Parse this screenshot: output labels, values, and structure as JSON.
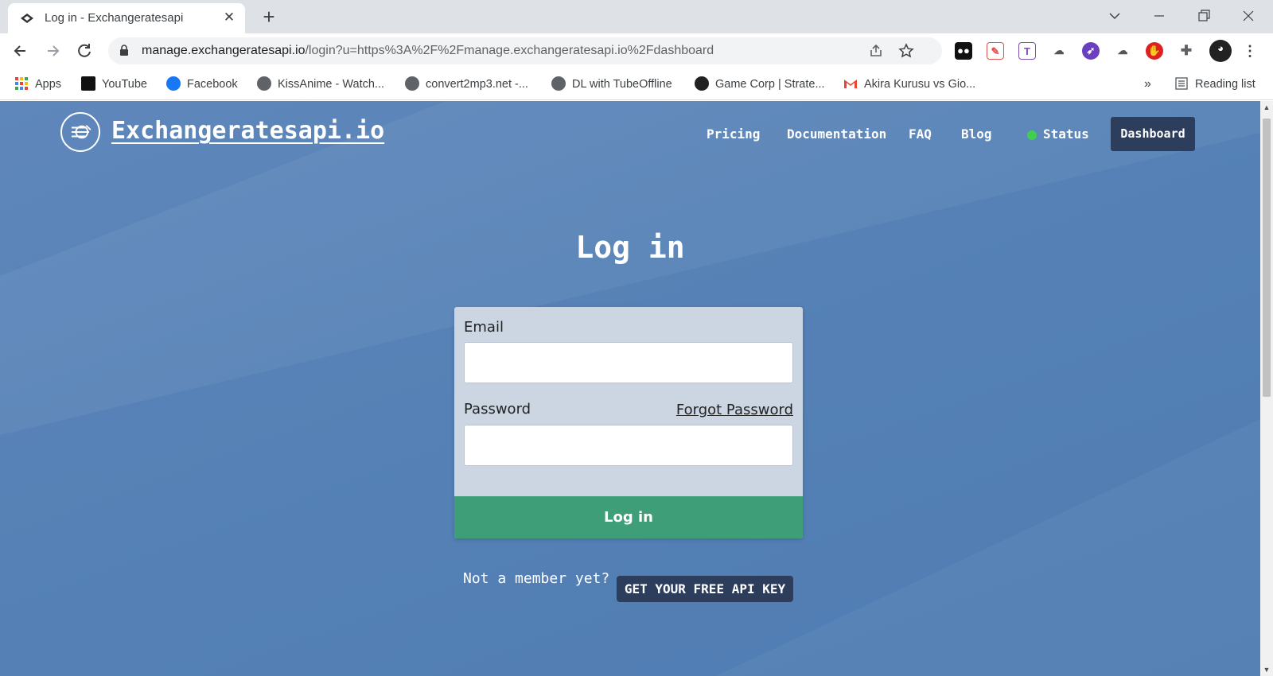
{
  "browser": {
    "tab_title": "Log in - Exchangeratesapi",
    "tab_close": "✕",
    "new_tab": "+",
    "url_host": "manage.exchangeratesapi.io",
    "url_path": "/login?u=https%3A%2F%2Fmanage.exchangeratesapi.io%2Fdashboard",
    "bookmarks": [
      {
        "label": "Apps",
        "icon": "apps-grid-icon"
      },
      {
        "label": "YouTube",
        "icon": "youtube-icon"
      },
      {
        "label": "Facebook",
        "icon": "facebook-icon"
      },
      {
        "label": "KissAnime - Watch...",
        "icon": "globe-icon"
      },
      {
        "label": "convert2mp3.net -...",
        "icon": "globe-icon"
      },
      {
        "label": "DL with TubeOffline",
        "icon": "globe-icon"
      },
      {
        "label": "Game Corp | Strate...",
        "icon": "github-icon"
      },
      {
        "label": "Akira Kurusu vs Gio...",
        "icon": "gmail-icon"
      }
    ],
    "bookmarks_overflow": "»",
    "reading_list": "Reading list"
  },
  "site": {
    "brand": "Exchangeratesapi.io",
    "nav": {
      "pricing": "Pricing",
      "documentation": "Documentation",
      "faq": "FAQ",
      "blog": "Blog",
      "status": "Status",
      "dashboard": "Dashboard"
    },
    "status_color": "#3fce4f"
  },
  "login": {
    "heading": "Log in",
    "email_label": "Email",
    "email_value": "",
    "password_label": "Password",
    "password_value": "",
    "forgot": "Forgot Password",
    "submit": "Log in",
    "not_member": "Not a member yet?",
    "free_key": "GET YOUR FREE API KEY"
  },
  "colors": {
    "page_bg": "#5581b6",
    "dark_button": "#2c3e5c",
    "login_button": "#3e9e78",
    "card_bg": "#cbd6e2"
  }
}
